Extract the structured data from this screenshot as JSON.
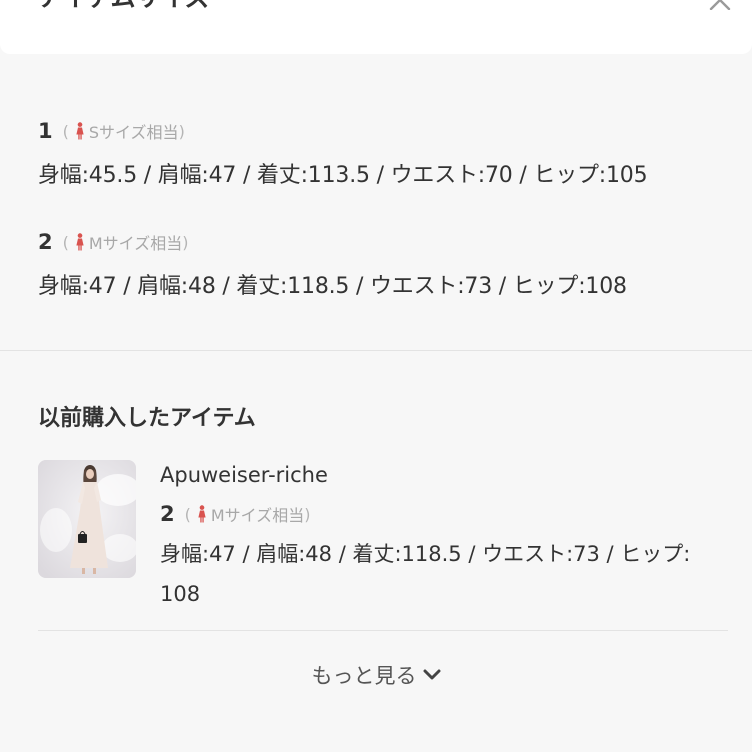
{
  "header": {
    "title": "アイテムサイズ"
  },
  "sizes": [
    {
      "number": "1",
      "open_paren": "(",
      "label": "Sサイズ相当",
      "close_paren": ")",
      "measurements": "身幅:45.5 / 肩幅:47 / 着丈:113.5 / ウエスト:70 / ヒップ:105"
    },
    {
      "number": "2",
      "open_paren": "(",
      "label": "Mサイズ相当",
      "close_paren": ")",
      "measurements": "身幅:47 / 肩幅:48 / 着丈:118.5 / ウエスト:73 / ヒップ:108"
    }
  ],
  "previous": {
    "title": "以前購入したアイテム",
    "brand": "Apuweiser-riche",
    "number": "2",
    "open_paren": "(",
    "label": "Mサイズ相当",
    "close_paren": ")",
    "measurements": "身幅:47 / 肩幅:48 / 着丈:118.5 / ウエスト:73 / ヒップ:108"
  },
  "more": {
    "label": "もっと見る"
  },
  "icons": {
    "person": "person-icon",
    "close": "close-icon",
    "more": "chevron-down-icon"
  },
  "colors": {
    "accent_person": "#d9534f",
    "background": "#f7f7f7"
  }
}
